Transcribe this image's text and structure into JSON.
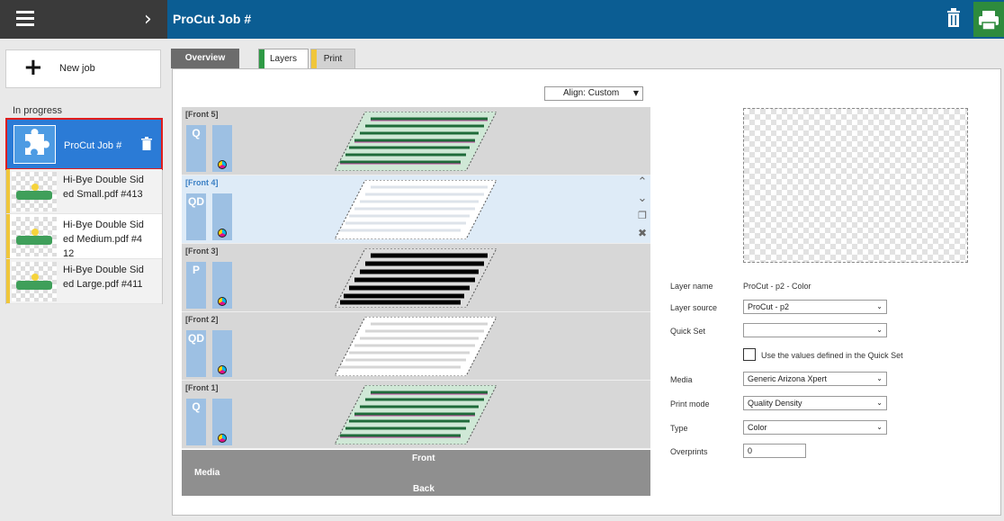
{
  "header": {
    "title": "ProCut Job #"
  },
  "sidebar": {
    "new_job_label": "New job",
    "section_label": "In progress",
    "selected_job": {
      "name": "ProCut Job #"
    },
    "jobs": [
      {
        "name": "Hi-Bye Double Sided Small.pdf #413"
      },
      {
        "name": "Hi-Bye Double Sided Medium.pdf #412"
      },
      {
        "name": "Hi-Bye Double Sided Large.pdf #411"
      }
    ]
  },
  "tabs": {
    "overview": "Overview",
    "layers": "Layers",
    "print": "Print"
  },
  "align": {
    "value": "Align: Custom"
  },
  "layers": [
    {
      "name": "[Front 5]",
      "mode": "Q",
      "style": "color"
    },
    {
      "name": "[Front 4]",
      "mode": "QD",
      "style": "white"
    },
    {
      "name": "[Front 3]",
      "mode": "P",
      "style": "black"
    },
    {
      "name": "[Front 2]",
      "mode": "QD",
      "style": "white"
    },
    {
      "name": "[Front 1]",
      "mode": "Q",
      "style": "color"
    }
  ],
  "media_bar": {
    "media": "Media",
    "front": "Front",
    "back": "Back"
  },
  "properties": {
    "layer_name_label": "Layer name",
    "layer_name_value": "ProCut - p2 - Color",
    "layer_source_label": "Layer source",
    "layer_source_value": "ProCut - p2",
    "quick_set_label": "Quick Set",
    "quick_set_value": "",
    "quick_set_check_label": "Use the values defined in the Quick Set",
    "media_label": "Media",
    "media_value": "Generic Arizona Xpert",
    "print_mode_label": "Print mode",
    "print_mode_value": "Quality Density",
    "type_label": "Type",
    "type_value": "Color",
    "overprints_label": "Overprints",
    "overprints_value": "0"
  },
  "colors": {
    "accent": "#0b5d93",
    "selected": "#2b7bd6",
    "print_green": "#2e8b3d",
    "layer_tab": "#2e9a45",
    "print_tab": "#f0c63a"
  }
}
